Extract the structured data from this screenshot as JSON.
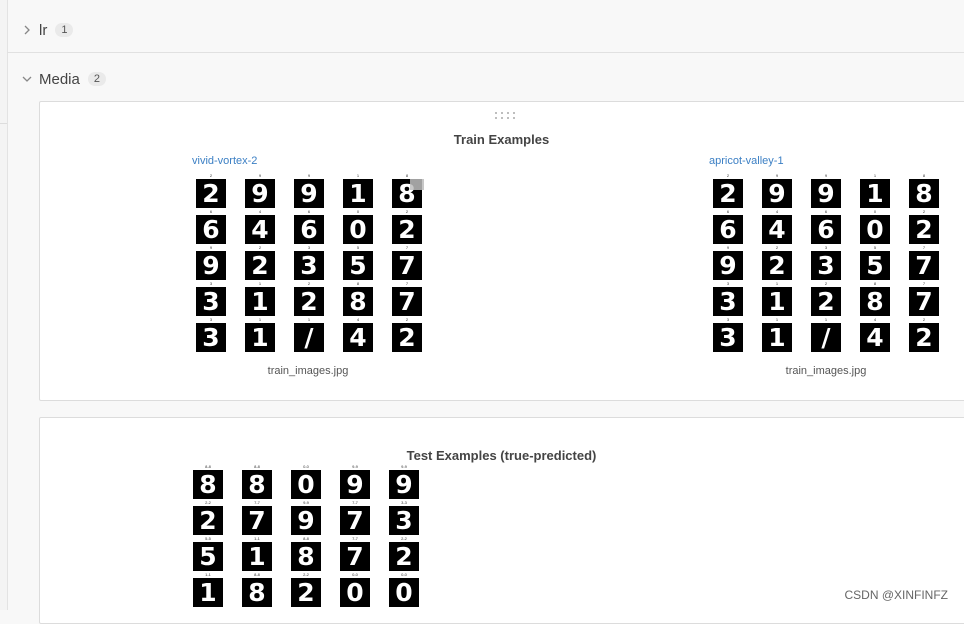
{
  "sections": {
    "lr": {
      "title": "lr",
      "count": "1"
    },
    "media": {
      "title": "Media",
      "count": "2"
    }
  },
  "icons": {
    "collapsed": "chevron-right-icon",
    "expanded": "chevron-down-icon",
    "drag": "drag-handle-icon"
  },
  "train_panel": {
    "title": "Train Examples",
    "runs": [
      {
        "name": "vivid-vortex-2",
        "caption": "train_images.jpg",
        "labels": [
          "2",
          "9",
          "9",
          "1",
          "8",
          "6",
          "4",
          "6",
          "0",
          "2",
          "9",
          "2",
          "3",
          "5",
          "7",
          "3",
          "1",
          "2",
          "8",
          "7",
          "3",
          "1",
          "1",
          "4",
          "2"
        ],
        "digits": [
          "2",
          "9",
          "9",
          "1",
          "8",
          "6",
          "4",
          "6",
          "0",
          "2",
          "9",
          "2",
          "3",
          "5",
          "7",
          "3",
          "1",
          "2",
          "8",
          "7",
          "3",
          "1",
          "/",
          "4",
          "2"
        ]
      },
      {
        "name": "apricot-valley-1",
        "caption": "train_images.jpg",
        "labels": [
          "2",
          "9",
          "9",
          "1",
          "8",
          "6",
          "4",
          "6",
          "0",
          "2",
          "9",
          "2",
          "3",
          "5",
          "7",
          "3",
          "1",
          "2",
          "8",
          "7",
          "3",
          "1",
          "1",
          "4",
          "2"
        ],
        "digits": [
          "2",
          "9",
          "9",
          "1",
          "8",
          "6",
          "4",
          "6",
          "0",
          "2",
          "9",
          "2",
          "3",
          "5",
          "7",
          "3",
          "1",
          "2",
          "8",
          "7",
          "3",
          "1",
          "/",
          "4",
          "2"
        ]
      }
    ]
  },
  "test_panel": {
    "title": "Test Examples (true-predicted)",
    "labels": [
      "8-8",
      "8-8",
      "0-0",
      "9-9",
      "9-9",
      "2-2",
      "7-7",
      "9-9",
      "7-7",
      "3-3",
      "5-5",
      "1-1",
      "8-8",
      "7-7",
      "2-2",
      "1-1",
      "8-8",
      "2-2",
      "0-0",
      "0-0"
    ],
    "digits": [
      "8",
      "8",
      "0",
      "9",
      "9",
      "2",
      "7",
      "9",
      "7",
      "3",
      "5",
      "1",
      "8",
      "7",
      "2",
      "1",
      "8",
      "2",
      "0",
      "0"
    ]
  },
  "watermark": "CSDN @XINFINFZ"
}
